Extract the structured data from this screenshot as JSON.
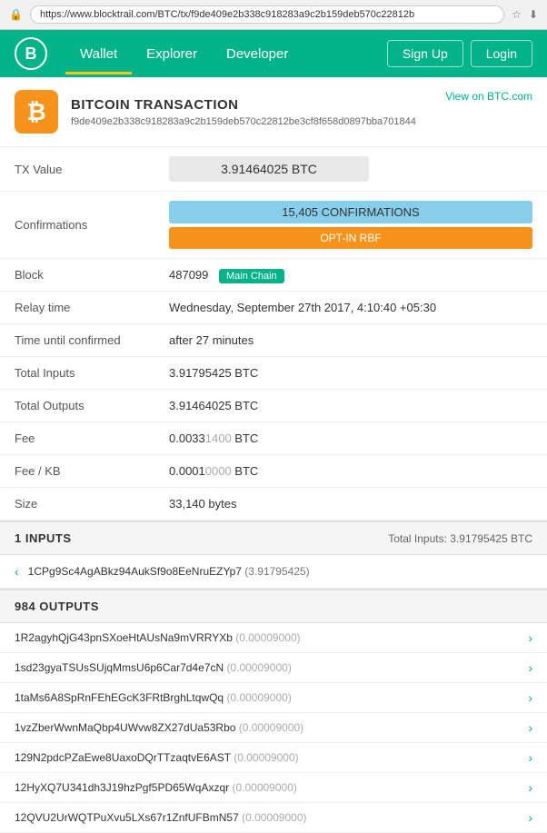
{
  "browser": {
    "url": "https://www.blocktrail.com/BTC/tx/f9de409e2b338c918283a9c2b159deb570c22812b",
    "lock_icon": "🔒"
  },
  "nav": {
    "logo": "B",
    "links": [
      {
        "label": "Wallet",
        "active": true
      },
      {
        "label": "Explorer",
        "active": false
      },
      {
        "label": "Developer",
        "active": false
      }
    ],
    "signup": "Sign Up",
    "login": "Login"
  },
  "transaction": {
    "title": "BITCOIN TRANSACTION",
    "view_link": "View on BTC.com",
    "hash": "f9de409e2b338c918283a9c2b159deb570c22812be3cf8f658d0897bba701844",
    "tx_value_label": "TX Value",
    "tx_value": "3.91464025 BTC",
    "confirmations_label": "Confirmations",
    "confirmations": "15,405 CONFIRMATIONS",
    "rbf": "OPT-IN RBF",
    "block_label": "Block",
    "block_num": "487099",
    "block_badge": "Main Chain",
    "relay_time_label": "Relay time",
    "relay_time": "Wednesday, September 27th 2017, 4:10:40 +05:30",
    "time_until_label": "Time until confirmed",
    "time_until": "after 27 minutes",
    "total_inputs_label": "Total Inputs",
    "total_inputs": "3.91795425 BTC",
    "total_outputs_label": "Total Outputs",
    "total_outputs": "3.91464025 BTC",
    "fee_label": "Fee",
    "fee": "0.00331400 BTC",
    "fee_per_kb_label": "Fee / KB",
    "fee_per_kb": "0.00010000 BTC",
    "size_label": "Size",
    "size": "33,140 bytes"
  },
  "inputs_section": {
    "title": "1 INPUTS",
    "total": "Total Inputs: 3.91795425 BTC",
    "items": [
      {
        "address": "1CPg9Sc4AgABkz94AukSf9o8EeNruEZYp7",
        "amount": "(3.91795425)"
      }
    ]
  },
  "outputs_section": {
    "title": "984 OUTPUTS",
    "items": [
      {
        "address": "1R2agyhQjG43pnSXoeHtAUsNa9mVRRYXb",
        "amount": "(0.00009000)"
      },
      {
        "address": "1sd23gyaTSUsSUjqMmsU6p6Car7d4e7cN",
        "amount": "(0.00009000)"
      },
      {
        "address": "1taMs6A8SpRnFEhEGcK3FRtBrghLtqwQq",
        "amount": "(0.00009000)"
      },
      {
        "address": "1vzZberWwnMaQbp4UWvw8ZX27dUa53Rbo",
        "amount": "(0.00009000)"
      },
      {
        "address": "129N2pdcPZaEwe8UaxoDQrTTzaqtvE6AST",
        "amount": "(0.00009000)"
      },
      {
        "address": "12HyXQ7U341dh3J19hzPgf5PD65WqAxzqr",
        "amount": "(0.00009000)"
      },
      {
        "address": "12QVU2UrWQTPuXvu5LXs67r1ZnfUFBmN57",
        "amount": "(0.00009000)"
      }
    ]
  }
}
